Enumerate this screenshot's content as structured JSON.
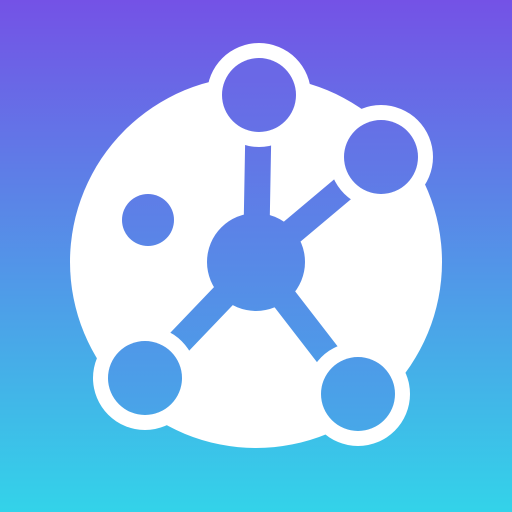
{
  "icon": {
    "name": "network-hub-app-icon",
    "colors": {
      "gradient_top": "#7452E6",
      "gradient_bottom": "#33D3E9",
      "glyph_fill": "#FFFFFF",
      "node_fill_top": "#6A68E6",
      "node_fill_bottom": "#46A9E8"
    }
  }
}
